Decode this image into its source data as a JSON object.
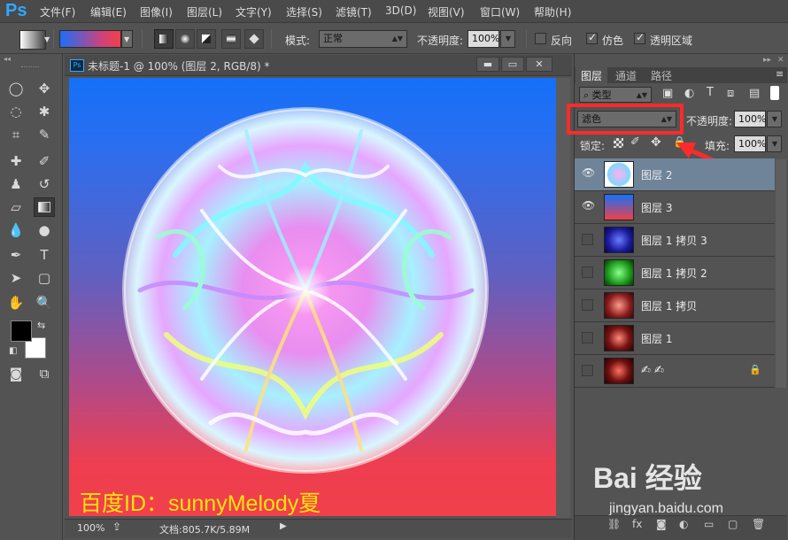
{
  "app": {
    "logo": "Ps"
  },
  "menu": [
    "文件(F)",
    "编辑(E)",
    "图像(I)",
    "图层(L)",
    "文字(Y)",
    "选择(S)",
    "滤镜(T)",
    "3D(D)",
    "视图(V)",
    "窗口(W)",
    "帮助(H)"
  ],
  "options": {
    "mode_label": "模式:",
    "mode_value": "正常",
    "opacity_label": "不透明度:",
    "opacity_value": "100%",
    "reverse_label": "反向",
    "dither_label": "仿色",
    "transparency_label": "透明区域",
    "reverse_checked": false,
    "dither_checked": true,
    "transparency_checked": true,
    "gradient_colors": [
      "#1e6df8",
      "#f0404c"
    ]
  },
  "document": {
    "title": "未标题-1 @ 100% (图层 2, RGB/8) *",
    "zoom": "100%",
    "doc_info": "文档:805.7K/5.89M",
    "watermark": "百度ID：sunnyMelody夏",
    "window_buttons": [
      "▬",
      "▭",
      "✕"
    ]
  },
  "panel": {
    "tabs": [
      "图层",
      "通道",
      "路径"
    ],
    "filter_kind": "类型",
    "blend_mode": "滤色",
    "opacity_label": "不透明度:",
    "opacity_value": "100%",
    "lock_label": "锁定:",
    "fill_label": "填充:",
    "fill_value": "100%",
    "layers": [
      {
        "name": "图层 2",
        "visible": true,
        "selected": true
      },
      {
        "name": "图层 3",
        "visible": true,
        "selected": false
      },
      {
        "name": "图层 1 拷贝 3",
        "visible": false,
        "selected": false
      },
      {
        "name": "图层 1 拷贝 2",
        "visible": false,
        "selected": false
      },
      {
        "name": "图层 1 拷贝",
        "visible": false,
        "selected": false
      },
      {
        "name": "图层 1",
        "visible": false,
        "selected": false
      },
      {
        "name": "",
        "visible": false,
        "selected": false,
        "locked": true
      }
    ]
  },
  "branding": {
    "baidu": "Bai 经验",
    "url": "jingyan.baidu.com"
  }
}
